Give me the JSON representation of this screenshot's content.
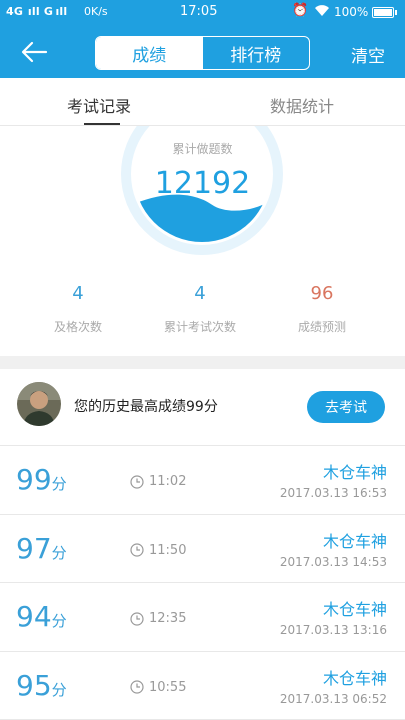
{
  "status_bar": {
    "signal": "4G  ıll G ıll",
    "network_speed": "0K/s",
    "time": "17:05",
    "battery": "100%"
  },
  "header": {
    "tabs": [
      {
        "label": "成绩",
        "active": true
      },
      {
        "label": "排行榜",
        "active": false
      }
    ],
    "clear_label": "清空"
  },
  "subtabs": [
    {
      "label": "考试记录",
      "active": true
    },
    {
      "label": "数据统计",
      "active": false
    }
  ],
  "gauge": {
    "label": "累计做题数",
    "value": "12192",
    "fill_fraction": 0.3
  },
  "stats": [
    {
      "value": "4",
      "label": "及格次数"
    },
    {
      "value": "4",
      "label": "累计考试次数"
    },
    {
      "value": "96",
      "label": "成绩预测"
    }
  ],
  "best": {
    "text": "您的历史最高成绩99分",
    "button": "去考试"
  },
  "records": [
    {
      "score": "99",
      "unit": "分",
      "duration": "11:02",
      "name": "木仓车神",
      "date": "2017.03.13  16:53"
    },
    {
      "score": "97",
      "unit": "分",
      "duration": "11:50",
      "name": "木仓车神",
      "date": "2017.03.13  14:53"
    },
    {
      "score": "94",
      "unit": "分",
      "duration": "12:35",
      "name": "木仓车神",
      "date": "2017.03.13  13:16"
    },
    {
      "score": "95",
      "unit": "分",
      "duration": "10:55",
      "name": "木仓车神",
      "date": "2017.03.13  06:52"
    }
  ],
  "colors": {
    "accent": "#1fa0e0",
    "stat_blue": "#3aa0d8",
    "stat_red": "#d9755f"
  }
}
